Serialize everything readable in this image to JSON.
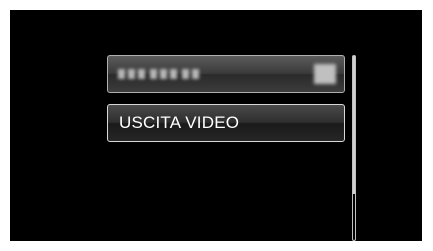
{
  "menu": {
    "items": [
      {
        "label": "",
        "state": "blurred-hidden-text"
      },
      {
        "label": "USCITA VIDEO"
      }
    ]
  },
  "scrollbar": {
    "position": 0.0,
    "visible_fraction": 0.74
  },
  "colors": {
    "screen_bg": "#000000",
    "item_border": "#c8c8c8",
    "text": "#ffffff"
  }
}
